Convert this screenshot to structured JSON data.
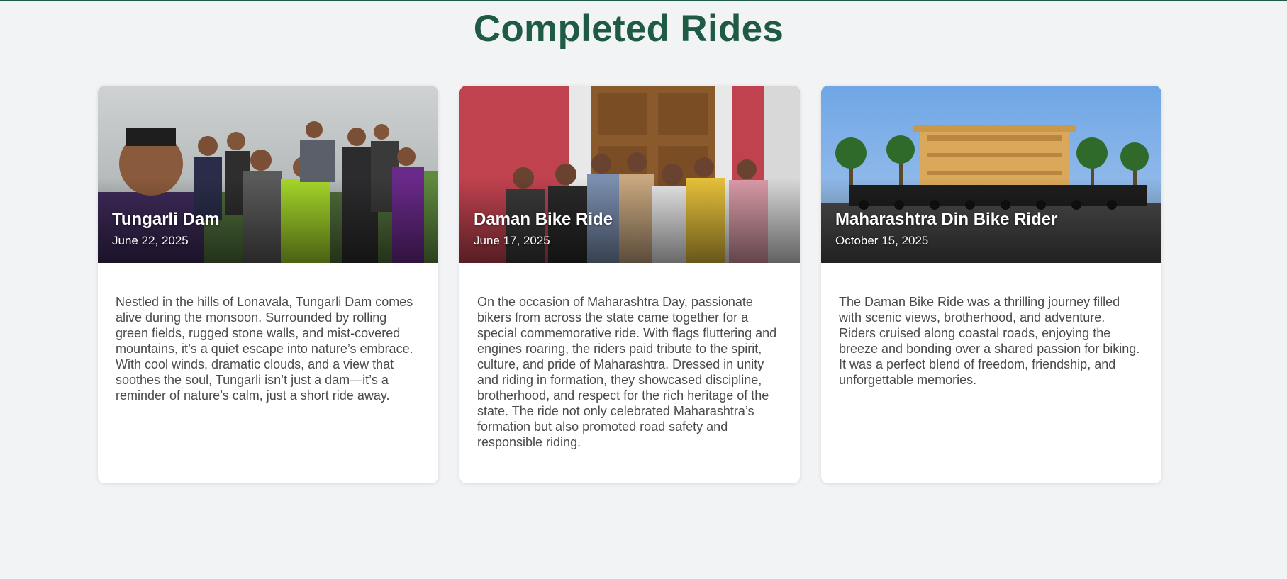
{
  "page": {
    "title": "Completed Rides"
  },
  "rides": [
    {
      "title": "Tungarli Dam",
      "date": "June 22, 2025",
      "description": "Nestled in the hills of Lonavala, Tungarli Dam comes alive during the monsoon. Surrounded by rolling green fields, rugged stone walls, and mist-covered mountains, it’s a quiet escape into nature’s embrace. With cool winds, dramatic clouds, and a view that soothes the soul, Tungarli isn’t just a dam—it’s a reminder of nature’s calm, just a short ride away.",
      "image": "group-selfie-photo"
    },
    {
      "title": "Daman Bike Ride",
      "date": "June 17, 2025",
      "description": "On the occasion of Maharashtra Day, passionate bikers from across the state came together for a special commemorative ride. With flags fluttering and engines roaring, the riders paid tribute to the spirit, culture, and pride of Maharashtra. Dressed in unity and riding in formation, they showcased discipline, brotherhood, and respect for the rich heritage of the state. The ride not only celebrated Maharashtra’s formation but also promoted road safety and responsible riding.",
      "image": "group-at-door-photo"
    },
    {
      "title": "Maharashtra Din Bike Rider",
      "date": "October 15, 2025",
      "description": "The Daman Bike Ride was a thrilling journey filled with scenic views, brotherhood, and adventure. Riders cruised along coastal roads, enjoying the breeze and bonding over a shared passion for biking. It was a perfect blend of freedom, friendship, and unforgettable memories.",
      "image": "bikes-at-hotel-photo"
    }
  ],
  "colors": {
    "accent": "#1f5a45",
    "background": "#f2f3f5",
    "card": "#ffffff",
    "text": "#4a4a4a"
  }
}
